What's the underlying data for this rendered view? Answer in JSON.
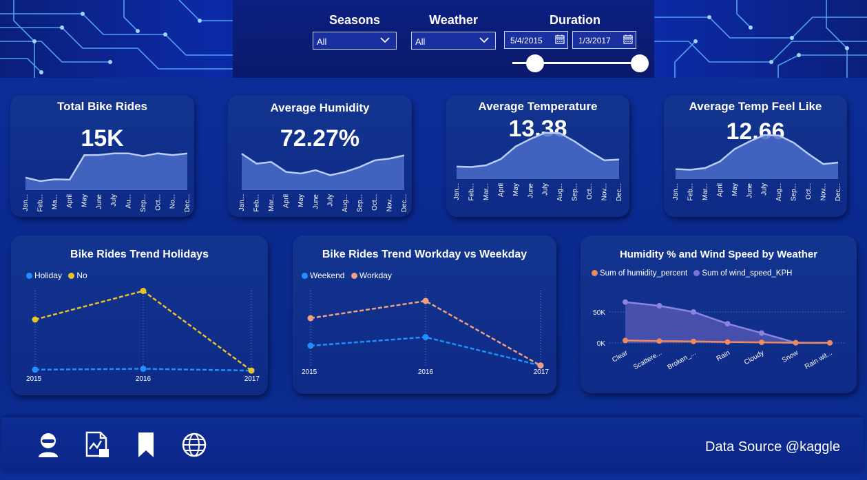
{
  "filters": {
    "seasons_label": "Seasons",
    "seasons_value": "All",
    "weather_label": "Weather",
    "weather_value": "All",
    "duration_label": "Duration",
    "date_start": "5/4/2015",
    "date_end": "1/3/2017"
  },
  "kpis": [
    {
      "title": "Total Bike Rides",
      "value": "15K"
    },
    {
      "title": "Average Humidity",
      "value": "72.27%"
    },
    {
      "title": "Average Temperature",
      "value": "13.38"
    },
    {
      "title": "Average Temp Feel Like",
      "value": "12.66"
    }
  ],
  "month_labels": [
    "Jan...",
    "Feb...",
    "Ma...",
    "April",
    "May",
    "June",
    "July",
    "Au...",
    "Sep...",
    "Oct...",
    "No...",
    "Dec..."
  ],
  "month_labels_b": [
    "Jan...",
    "Feb...",
    "Mar...",
    "April",
    "May",
    "June",
    "July",
    "Aug...",
    "Sep...",
    "Oct...",
    "Nov...",
    "Dec..."
  ],
  "month_labels_c": [
    "Jan...",
    "Feb...",
    "Mar...",
    "April",
    "May",
    "June",
    "July",
    "Aug...",
    "Sep...",
    "Oct...",
    "Nov...",
    "Dec..."
  ],
  "charts": {
    "holidays": {
      "title": "Bike Rides Trend Holidays",
      "legend": [
        {
          "name": "Holiday",
          "color": "#1e90ff"
        },
        {
          "name": "No",
          "color": "#e8c22a"
        }
      ]
    },
    "workday": {
      "title": "Bike Rides Trend Workday vs Weekday",
      "legend": [
        {
          "name": "Weekend",
          "color": "#1e90ff"
        },
        {
          "name": "Workday",
          "color": "#f0a080"
        }
      ]
    },
    "humidity_wind": {
      "title": "Humidity % and Wind Speed by Weather",
      "legend": [
        {
          "name": "Sum of humidity_percent",
          "color": "#f08a5d"
        },
        {
          "name": "Sum of wind_speed_KPH",
          "color": "#7b73d6"
        }
      ]
    }
  },
  "chart_data": [
    {
      "type": "area",
      "categories": [
        "Jan",
        "Feb",
        "Mar",
        "April",
        "May",
        "June",
        "July",
        "Aug",
        "Sep",
        "Oct",
        "Nov",
        "Dec"
      ],
      "values": [
        700,
        500,
        600,
        580,
        1950,
        1960,
        2050,
        2050,
        1900,
        2050,
        1950,
        2050
      ],
      "ylim": [
        0,
        3000
      ]
    },
    {
      "type": "area",
      "categories": [
        "Jan",
        "Feb",
        "Mar",
        "April",
        "May",
        "June",
        "July",
        "Aug",
        "Sep",
        "Oct",
        "Nov",
        "Dec"
      ],
      "values": [
        77,
        71,
        72,
        66,
        65,
        67,
        64,
        66,
        69,
        73,
        74,
        76
      ],
      "ylim": [
        55,
        85
      ]
    },
    {
      "type": "area",
      "categories": [
        "Jan",
        "Feb",
        "Mar",
        "April",
        "May",
        "June",
        "July",
        "Aug",
        "Sep",
        "Oct",
        "Nov",
        "Dec"
      ],
      "values": [
        5,
        4.8,
        5.5,
        8,
        13,
        16,
        18.5,
        18.3,
        15,
        11,
        7.5,
        7.8
      ],
      "ylim": [
        0,
        22
      ]
    },
    {
      "type": "area",
      "categories": [
        "Jan",
        "Feb",
        "Mar",
        "April",
        "May",
        "June",
        "July",
        "Aug",
        "Sep",
        "Oct",
        "Nov",
        "Dec"
      ],
      "values": [
        4,
        3.7,
        4.4,
        7,
        12,
        15,
        17.6,
        17.4,
        14.5,
        10,
        6,
        6.6
      ],
      "ylim": [
        0,
        22
      ]
    },
    {
      "type": "line",
      "x": [
        "2015",
        "2016",
        "2017"
      ],
      "series": [
        {
          "name": "Holiday",
          "values": [
            0.4,
            0.5,
            0.3
          ]
        },
        {
          "name": "No",
          "values": [
            6.0,
            9.2,
            0.3
          ]
        }
      ],
      "ylim": [
        0,
        10
      ]
    },
    {
      "type": "line",
      "x": [
        "2015",
        "2016",
        "2017"
      ],
      "series": [
        {
          "name": "Weekend",
          "values": [
            2.8,
            3.8,
            0.5
          ]
        },
        {
          "name": "Workday",
          "values": [
            6.0,
            8.0,
            0.5
          ]
        }
      ],
      "ylim": [
        0,
        10
      ]
    },
    {
      "type": "area",
      "categories": [
        "Clear",
        "Scattere...",
        "Broken_...",
        "Rain",
        "Cloudy",
        "Snow",
        "Rain wit..."
      ],
      "series": [
        {
          "name": "Sum of humidity_percent",
          "values": [
            4000,
            3000,
            2500,
            1500,
            1000,
            200,
            100
          ]
        },
        {
          "name": "Sum of wind_speed_KPH",
          "values": [
            66000,
            60000,
            50000,
            31000,
            16000,
            500,
            200
          ]
        }
      ],
      "yticks": [
        "0K",
        "50K"
      ],
      "ylim": [
        0,
        80000
      ]
    }
  ],
  "footer": {
    "source": "Data Source @kaggle",
    "icons": [
      "user-icon",
      "report-icon",
      "bookmark-icon",
      "globe-icon"
    ]
  }
}
